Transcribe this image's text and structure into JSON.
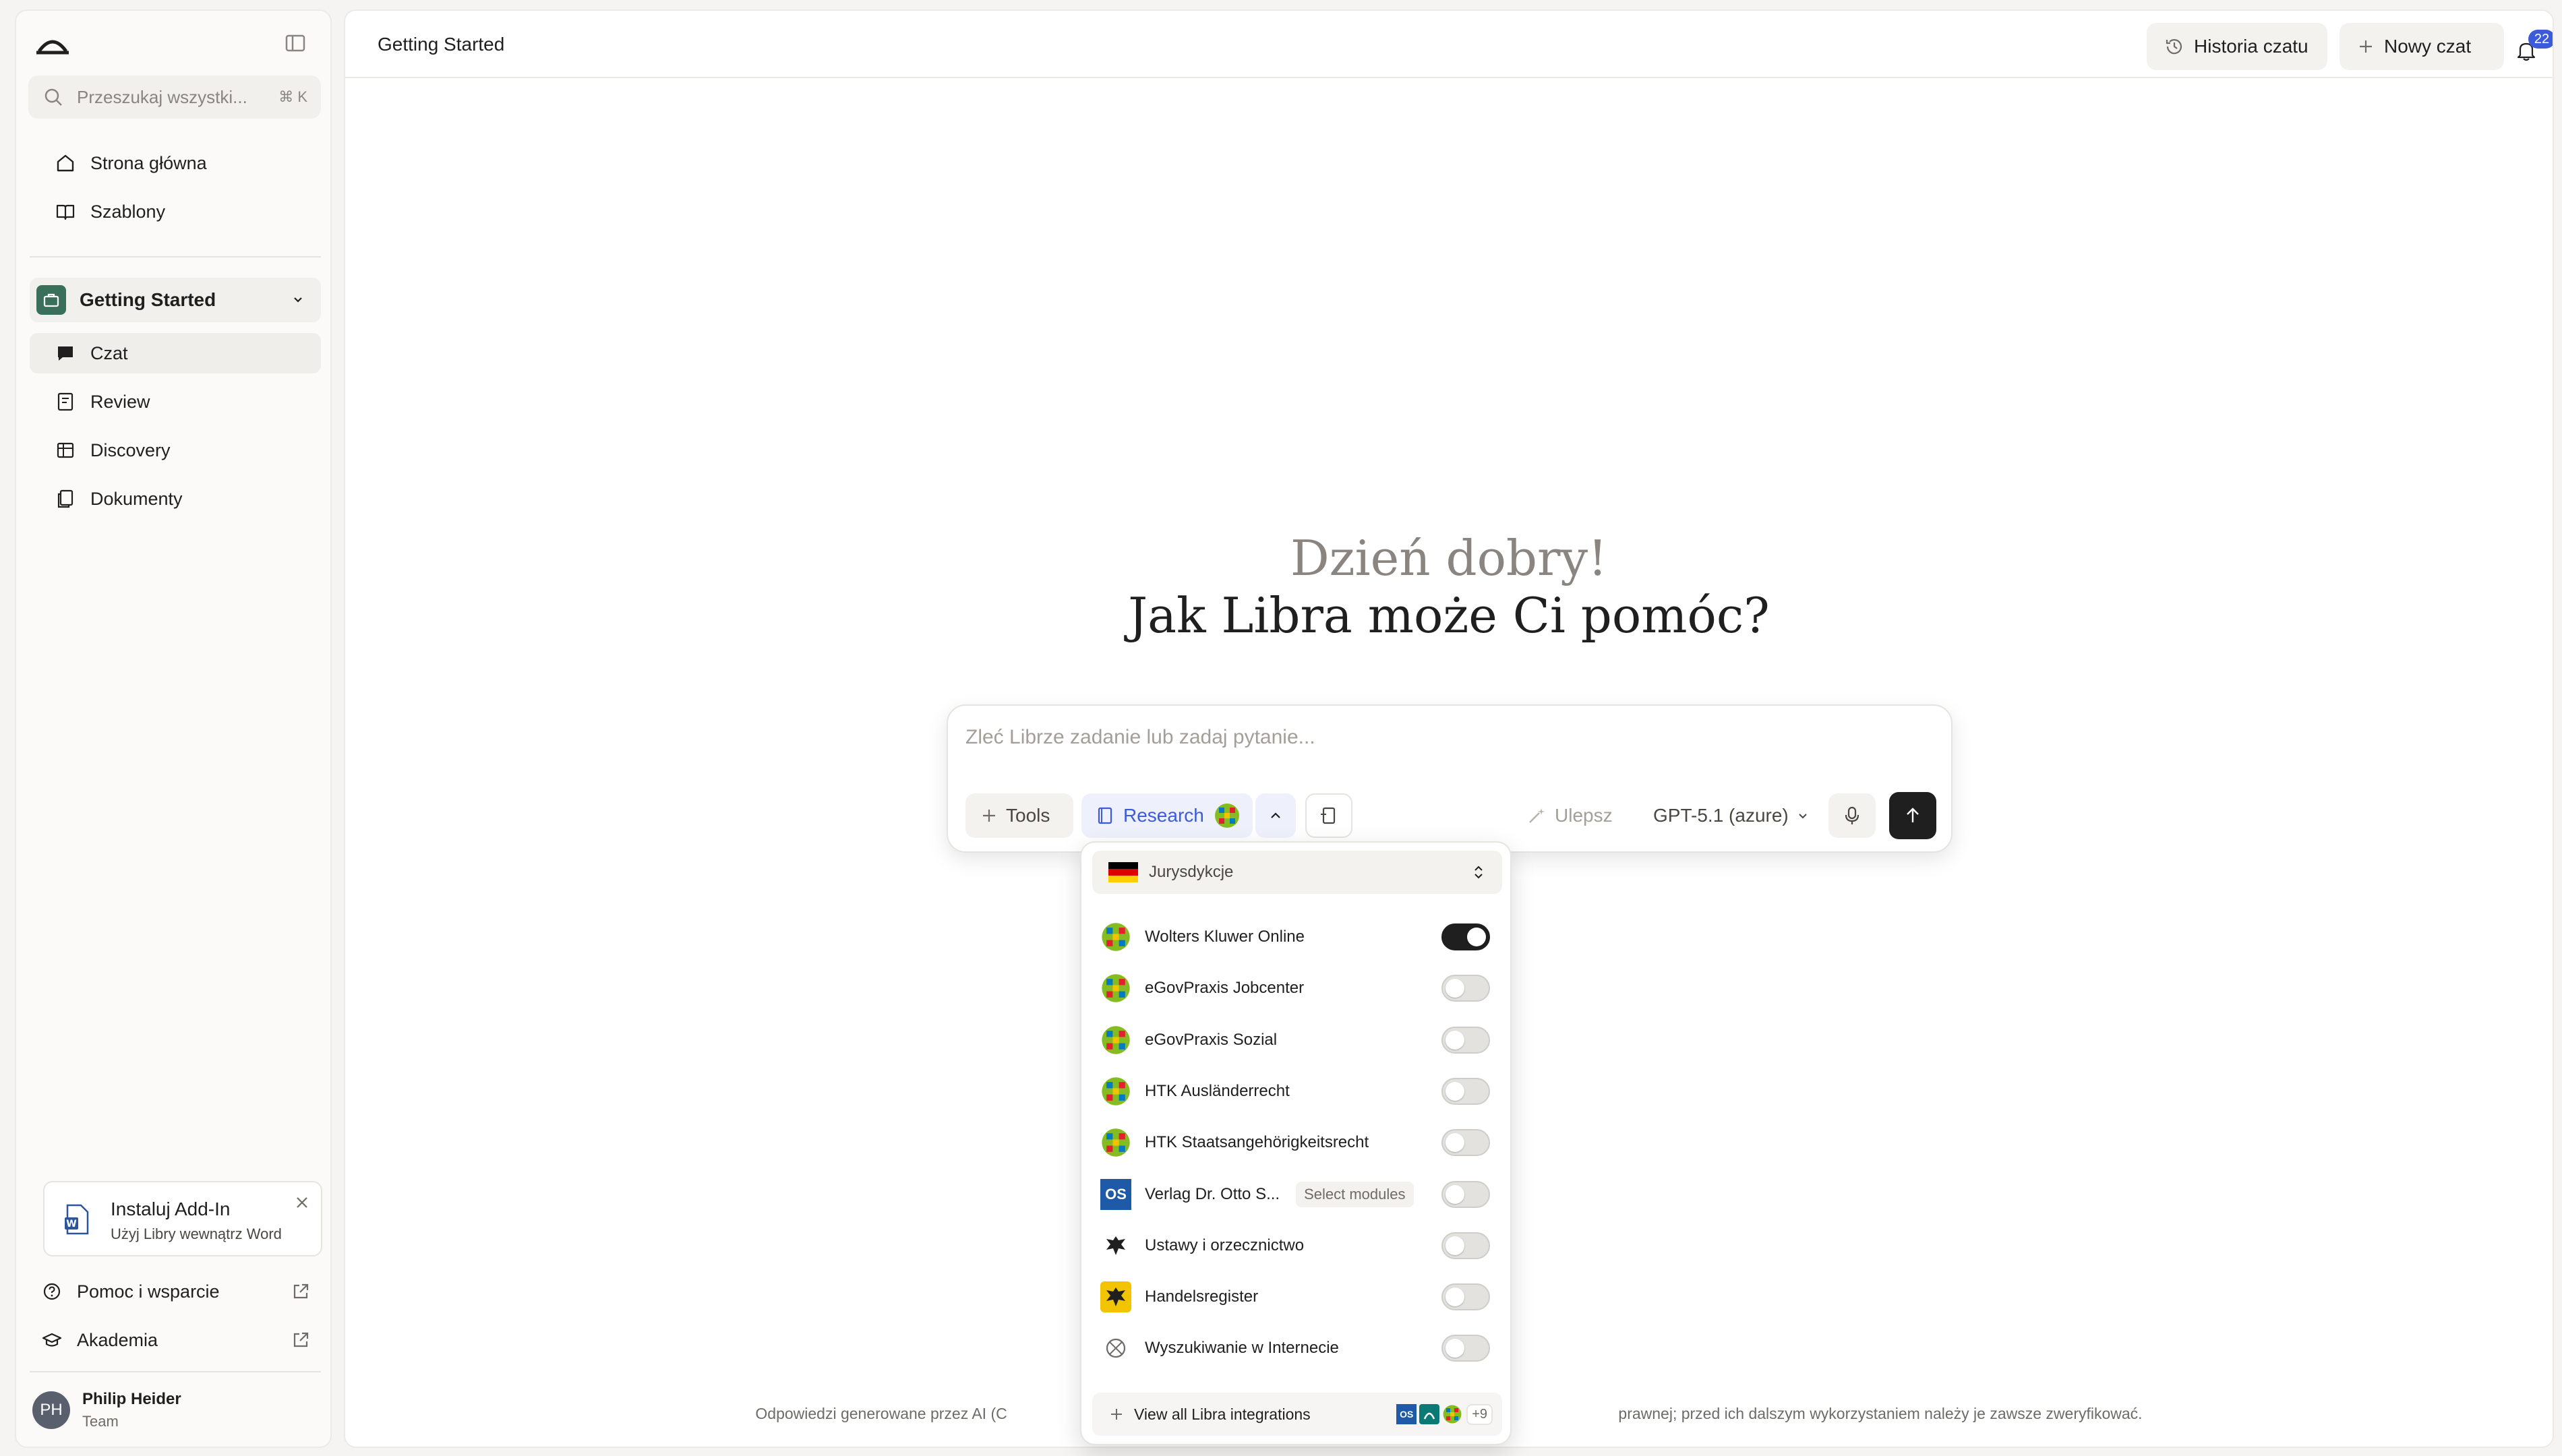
{
  "sidebar": {
    "search_placeholder": "Przeszukaj wszystki...",
    "search_shortcut": "⌘ K",
    "nav": [
      {
        "label": "Strona główna",
        "icon": "home-icon"
      },
      {
        "label": "Szablony",
        "icon": "book-icon"
      }
    ],
    "workspace": {
      "label": "Getting Started",
      "icon": "briefcase-icon"
    },
    "workspace_items": [
      {
        "label": "Czat",
        "icon": "chat-icon",
        "active": true
      },
      {
        "label": "Review",
        "icon": "review-icon"
      },
      {
        "label": "Discovery",
        "icon": "table-icon"
      },
      {
        "label": "Dokumenty",
        "icon": "documents-icon"
      }
    ],
    "addin": {
      "title": "Instaluj Add-In",
      "subtitle": "Użyj Libry wewnątrz Word"
    },
    "footer_links": [
      {
        "label": "Pomoc i wsparcie",
        "icon": "help-icon"
      },
      {
        "label": "Akademia",
        "icon": "graduation-icon"
      }
    ],
    "user": {
      "initials": "PH",
      "name": "Philip Heider",
      "role": "Team"
    }
  },
  "header": {
    "title": "Getting Started",
    "history_label": "Historia czatu",
    "new_chat_label": "Nowy czat",
    "notification_count": "22"
  },
  "greeting": {
    "line1": "Dzień dobry!",
    "line2": "Jak Libra może Ci pomóc?"
  },
  "composer": {
    "placeholder": "Zleć Librze zadanie lub zadaj pytanie...",
    "tools_label": "Tools",
    "research_label": "Research",
    "improve_label": "Ulepsz",
    "model_label": "GPT-5.1 (azure)"
  },
  "dropdown": {
    "jurisdiction_label": "Jurysdykcje",
    "integrations": [
      {
        "name": "Wolters Kluwer Online",
        "logo": "wolters-kluwer-logo",
        "enabled": true
      },
      {
        "name": "eGovPraxis Jobcenter",
        "logo": "wolters-kluwer-logo",
        "enabled": false
      },
      {
        "name": "eGovPraxis Sozial",
        "logo": "wolters-kluwer-logo",
        "enabled": false
      },
      {
        "name": "HTK Ausländerrecht",
        "logo": "wolters-kluwer-logo",
        "enabled": false
      },
      {
        "name": "HTK Staatsangehörigkeitsrecht",
        "logo": "wolters-kluwer-logo",
        "enabled": false
      },
      {
        "name": "Verlag Dr. Otto S...",
        "logo": "otto-schmidt-logo",
        "enabled": false,
        "extra": "Select modules"
      },
      {
        "name": "Ustawy i orzecznictwo",
        "logo": "eagle-icon",
        "enabled": false
      },
      {
        "name": "Handelsregister",
        "logo": "handelsregister-logo",
        "enabled": false
      },
      {
        "name": "Wyszukiwanie w Internecie",
        "logo": "globe-icon",
        "enabled": false
      }
    ],
    "view_all_label": "View all Libra integrations",
    "more_count": "+9",
    "os_badge": "OS"
  },
  "footer": {
    "left": "Odpowiedzi generowane przez AI (C",
    "right": "prawnej; przed ich dalszym wykorzystaniem należy je zawsze zweryfikować."
  },
  "colors": {
    "accent": "#1f1f1f",
    "research": "#3b5bdb",
    "wk_green": "#85bc22",
    "os_blue": "#1e5aa8"
  }
}
